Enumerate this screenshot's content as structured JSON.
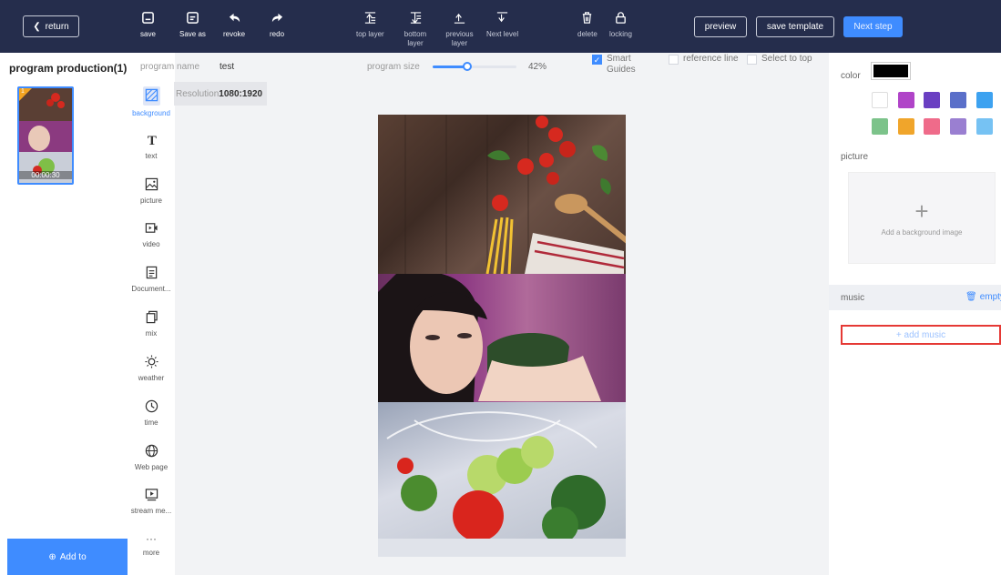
{
  "toolbar": {
    "return_label": "return",
    "items": [
      {
        "label": "save"
      },
      {
        "label": "Save as"
      },
      {
        "label": "revoke"
      },
      {
        "label": "redo"
      },
      {
        "label": "top layer"
      },
      {
        "label": "bottom layer"
      },
      {
        "label": "previous layer"
      },
      {
        "label": "Next level"
      },
      {
        "label": "delete"
      },
      {
        "label": "locking"
      }
    ],
    "preview_label": "preview",
    "save_template_label": "save template",
    "next_label": "Next step"
  },
  "program": {
    "title": "program production(1)",
    "name_label": "program name",
    "name_value": "test",
    "size_label": "program size",
    "size_percent": "42%",
    "size_value": 0.42
  },
  "options": {
    "smart_guides": "Smart Guides",
    "smart_guides_checked": true,
    "reference_line": "reference line",
    "select_to_top": "Select to top"
  },
  "resolution": {
    "label": "Resolution",
    "value": "1080:1920"
  },
  "thumbnail": {
    "index": "1",
    "duration": "00:00:30"
  },
  "tools": [
    {
      "label": "background",
      "icon": "background-icon"
    },
    {
      "label": "text",
      "icon": "text-icon"
    },
    {
      "label": "picture",
      "icon": "picture-icon"
    },
    {
      "label": "video",
      "icon": "video-icon"
    },
    {
      "label": "Document...",
      "icon": "document-icon"
    },
    {
      "label": "mix",
      "icon": "mix-icon"
    },
    {
      "label": "weather",
      "icon": "weather-icon"
    },
    {
      "label": "time",
      "icon": "clock-icon"
    },
    {
      "label": "Web page",
      "icon": "globe-icon"
    },
    {
      "label": "stream me...",
      "icon": "stream-icon"
    },
    {
      "label": "more",
      "icon": "more-icon"
    }
  ],
  "add_to_label": "Add to",
  "right_panel": {
    "color_label": "color",
    "selected_color": "#000000",
    "palette": [
      "#ffffff",
      "#b044c8",
      "#6a3fc2",
      "#5a6fc9",
      "#3da2f0",
      "#7cc38a",
      "#f0a52b",
      "#ef6b8a",
      "#9a7fd1",
      "#76c2f3"
    ],
    "picture_label": "picture",
    "add_bg_label": "Add a background image",
    "music_label": "music",
    "empty_label": "empty",
    "add_music_label": "+ add music"
  },
  "colors": {
    "accent": "#3f8cff",
    "topbar": "#252d4c",
    "highlight": "#e53935"
  }
}
